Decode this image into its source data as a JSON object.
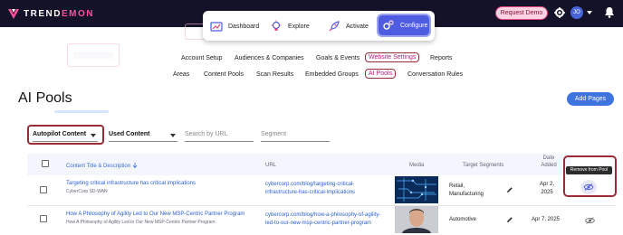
{
  "brand": {
    "name_prefix": "TREND",
    "name_suffix": "EMON",
    "accent": "#ff4f9a"
  },
  "topbar": {
    "request_demo": "Request Demo",
    "avatar_initials": "JO",
    "icons": [
      "settings-icon",
      "chevron-down-icon",
      "bell-icon"
    ]
  },
  "mega_menu": {
    "items": [
      {
        "label": "Dashboard",
        "icon": "dashboard-icon"
      },
      {
        "label": "Explore",
        "icon": "lightbulb-icon"
      },
      {
        "label": "Activate",
        "icon": "rocket-icon"
      },
      {
        "label": "Configure",
        "icon": "gears-icon",
        "active": true
      }
    ]
  },
  "nav": {
    "row1": [
      "Account Setup",
      "Audiences & Companies",
      "Goals & Events",
      "Website Settings",
      "Reports"
    ],
    "row2": [
      "Areas",
      "Content Pools",
      "Scan Results",
      "Embedded Groups",
      "AI Pools",
      "Conversation Rules"
    ],
    "highlighted": [
      "Website Settings",
      "AI Pools"
    ]
  },
  "page": {
    "title": "AI Pools",
    "add_button": "Add Pages"
  },
  "filters": {
    "pool_type": "Autopilot Content",
    "content_type": "Used Content",
    "search_placeholder": "Search by URL",
    "segment_placeholder": "Segment"
  },
  "table": {
    "headers": {
      "title": "Content Title & Description",
      "sort_icon": "arrow-down-icon",
      "url": "URL",
      "media": "Media",
      "segments": "Target Segments",
      "date_line1": "Date",
      "date_line2": "Added"
    },
    "tooltip": "Remove from Pool",
    "rows": [
      {
        "title": "Targeting critical infrastructure has critical implications",
        "subtitle": "CyberCorp SD-WAN",
        "url_line1": "cybercorp.com/blog/targeting-critical-",
        "url_line2": "infrastructure-has-critical-implications",
        "media": "circuit-board-image",
        "segments_line1": "Retail,",
        "segments_line2": "Manufacturing",
        "date_line1": "Apr 2,",
        "date_line2": "2025"
      },
      {
        "title": "How A Philosophy of Agility Led to Our New MSP-Centric Partner Program",
        "subtitle": "How A Philosophy of Agility Led to Our New MSP-Centric Partner Program",
        "url_line1": "cybercorp.com/blog/how-a-philosophy-of-agility-",
        "url_line2": "led-to-our-new-msp-centric-partner-program",
        "media": "portrait-image",
        "segments_line1": "Automotive",
        "segments_line2": "",
        "date_line1": "Apr 7, 2025",
        "date_line2": ""
      }
    ]
  }
}
